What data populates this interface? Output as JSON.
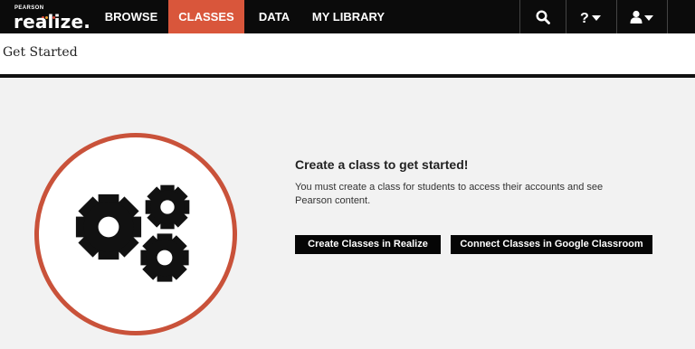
{
  "brand": {
    "company": "PEARSON",
    "product": "realize.",
    "dot_colors": [
      "#e0483a",
      "#f0a030",
      "#3aa0e0",
      "#e0483a"
    ]
  },
  "nav": {
    "items": [
      {
        "label": "BROWSE"
      },
      {
        "label": "CLASSES",
        "active": true
      },
      {
        "label": "DATA"
      },
      {
        "label": "MY LIBRARY"
      }
    ],
    "icons": [
      "search-icon",
      "help-icon",
      "user-icon"
    ]
  },
  "header": {
    "title": "Get Started"
  },
  "main": {
    "heading": "Create a class to get started!",
    "description": "You must create a class for students to access their accounts and see Pearson content.",
    "buttons": {
      "create": "Create Classes in Realize",
      "connect": "Connect Classes in Google Classroom"
    }
  },
  "colors": {
    "accent": "#d9563b",
    "nav_bg": "#0b0b0b",
    "ring": "#c9523a"
  }
}
